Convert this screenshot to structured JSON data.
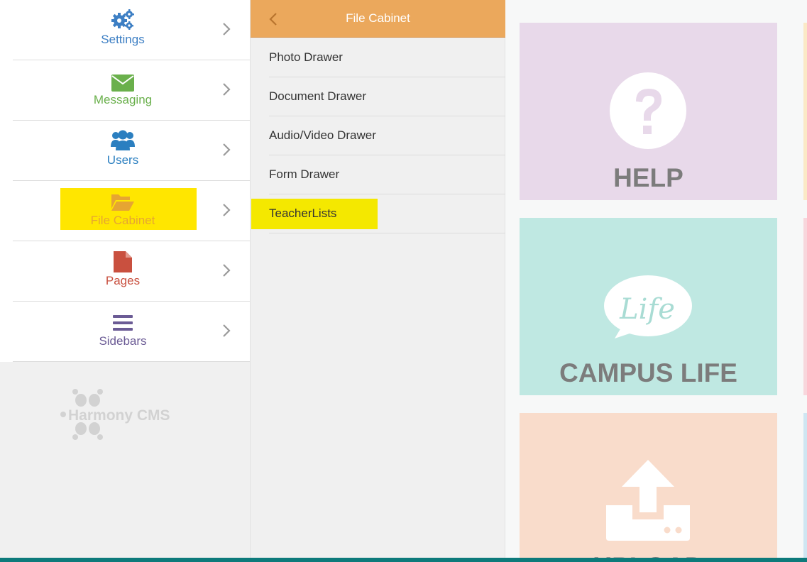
{
  "nav": {
    "items": [
      {
        "label": "Settings",
        "icon": "gears-icon",
        "color": "#3d7fc4"
      },
      {
        "label": "Messaging",
        "icon": "envelope-icon",
        "color": "#6ab04c"
      },
      {
        "label": "Users",
        "icon": "users-icon",
        "color": "#2b7fc0"
      },
      {
        "label": "File Cabinet",
        "icon": "folder-open-icon",
        "color": "#e6a532",
        "highlight": "#ffe600"
      },
      {
        "label": "Pages",
        "icon": "file-icon",
        "color": "#c9503f"
      },
      {
        "label": "Sidebars",
        "icon": "bars-icon",
        "color": "#6b5b95"
      }
    ],
    "logo_text": "Harmony CMS"
  },
  "submenu": {
    "title": "File Cabinet",
    "header_color": "#eba85c",
    "items": [
      {
        "label": "Photo Drawer"
      },
      {
        "label": "Document Drawer"
      },
      {
        "label": "Audio/Video Drawer"
      },
      {
        "label": "Form Drawer"
      },
      {
        "label": "TeacherLists",
        "highlight": "#f4e800"
      }
    ]
  },
  "tiles": [
    {
      "label": "HELP",
      "color": "#e8d9ea",
      "icon": "question-circle-icon"
    },
    {
      "label": "CAMPUS LIFE",
      "color": "#bfe8e2",
      "icon": "life-speech-bubble-icon",
      "icon_text": "Life"
    },
    {
      "label": "UPLOAD",
      "color": "#f9dccb",
      "icon": "upload-icon"
    }
  ],
  "colors": {
    "bottom_bar": "#0d7a7b"
  }
}
